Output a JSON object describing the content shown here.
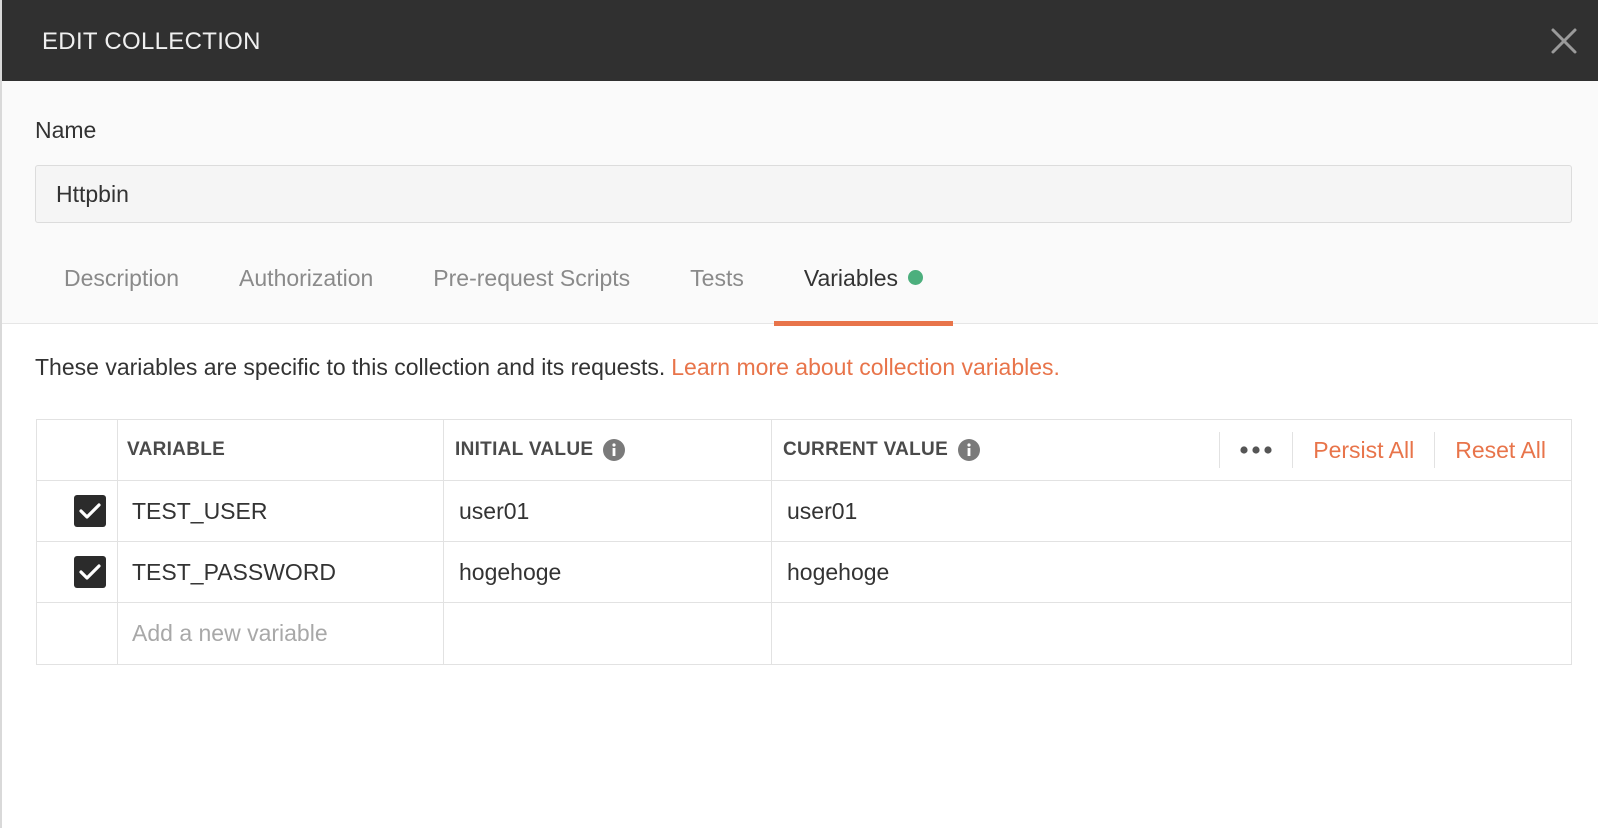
{
  "modal": {
    "title": "EDIT COLLECTION"
  },
  "name_field": {
    "label": "Name",
    "value": "Httpbin"
  },
  "tabs": [
    {
      "label": "Description"
    },
    {
      "label": "Authorization"
    },
    {
      "label": "Pre-request Scripts"
    },
    {
      "label": "Tests"
    },
    {
      "label": "Variables",
      "active": true,
      "indicator_color": "#4caf7d"
    }
  ],
  "variables_panel": {
    "description": "These variables are specific to this collection and its requests.",
    "learn_more_link": "Learn more about collection variables.",
    "columns": {
      "variable": "VARIABLE",
      "initial_value": "INITIAL VALUE",
      "current_value": "CURRENT VALUE"
    },
    "actions": {
      "more_icon": "ellipsis-icon",
      "persist_all": "Persist All",
      "reset_all": "Reset All"
    },
    "rows": [
      {
        "enabled": true,
        "variable": "TEST_USER",
        "initial_value": "user01",
        "current_value": "user01"
      },
      {
        "enabled": true,
        "variable": "TEST_PASSWORD",
        "initial_value": "hogehoge",
        "current_value": "hogehoge"
      }
    ],
    "new_row_placeholder": "Add a new variable"
  },
  "colors": {
    "header_bg": "#303030",
    "accent": "#e8744a",
    "indicator": "#4caf7d",
    "checkbox": "#2b2b2b"
  }
}
